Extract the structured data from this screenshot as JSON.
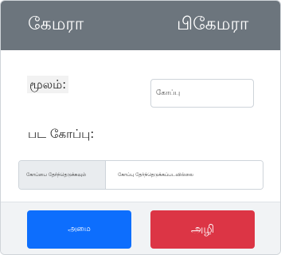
{
  "header": {
    "title_left": "கேமரா",
    "title_right": "பிகேமரா"
  },
  "form": {
    "source_label": "மூலம்:",
    "source_value": "கோப்பு",
    "copy_label": "பட கோப்பு:",
    "copy_addon": "கோப்பை தேர்ந்தெடுக்கவும்",
    "copy_value": "கோப்பு தேர்ந்தெடுக்கப்படவில்லை"
  },
  "footer": {
    "primary_label": "அமை",
    "danger_label": "அழி"
  },
  "colors": {
    "header_bg": "#6c757d",
    "primary": "#0d6efd",
    "danger": "#dc3545"
  }
}
